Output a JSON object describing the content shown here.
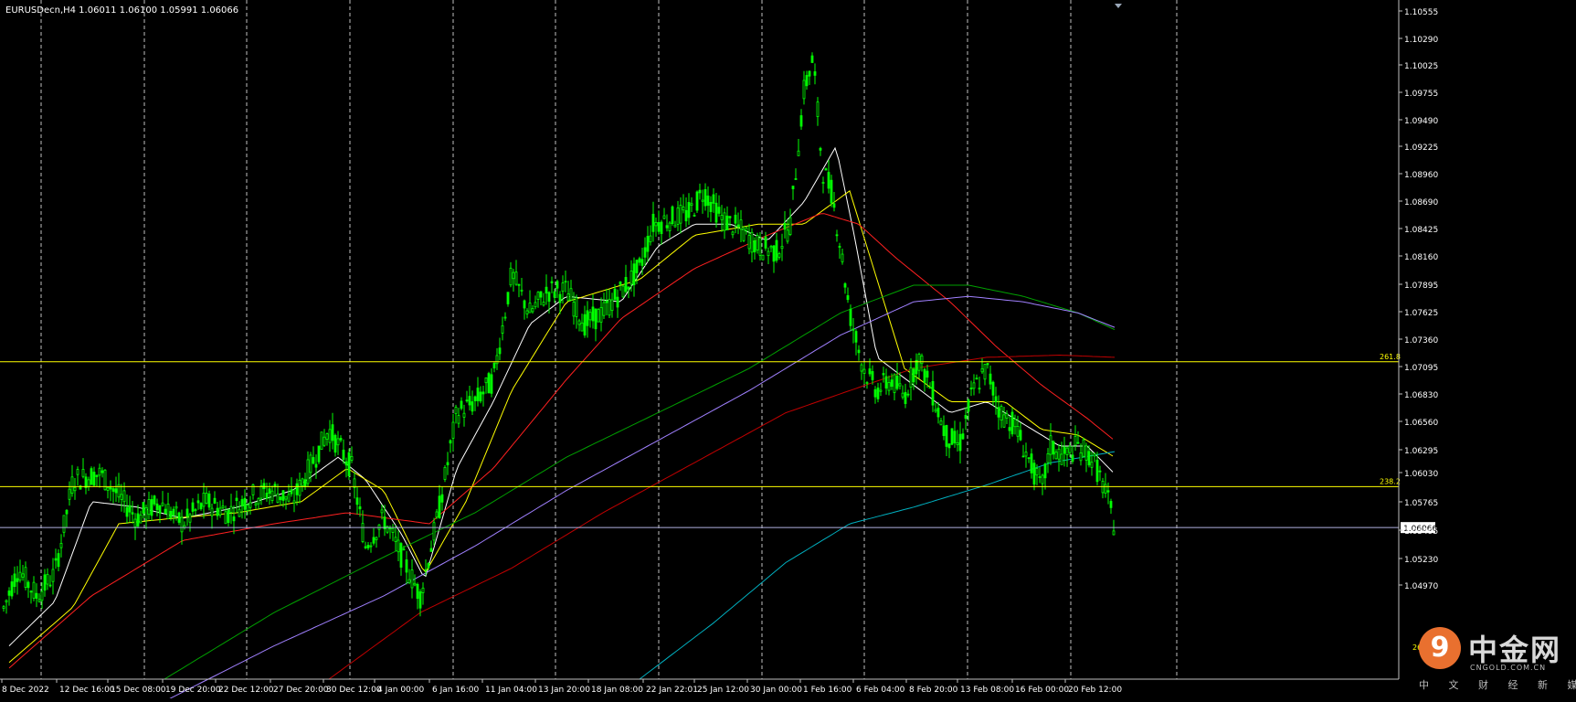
{
  "window": {
    "symbol_header": "EURUSDecn,H4  1.06011 1.06100 1.05991 1.06066"
  },
  "colors": {
    "background": "#000000",
    "axis": "#c0c0c0",
    "grid": "#c0c0c0",
    "bull": "#00ff00",
    "fib": "#ffff00",
    "bidline": "#b0b0e0",
    "ma_white": "#ffffff",
    "ma_yellow": "#ffff00",
    "ma_red": "#ff2020",
    "ma_green": "#00a000",
    "ma_violet": "#a080ff",
    "ma_darkred": "#c00000",
    "ma_cyan": "#00b0c0"
  },
  "chart_data": {
    "type": "candlestick",
    "timeframe": "H4",
    "ylim": [
      1.047,
      1.1082
    ],
    "y_ticks": [
      "1.10555",
      "1.10290",
      "1.10025",
      "1.09755",
      "1.09490",
      "1.09225",
      "1.08960",
      "1.08690",
      "1.08425",
      "1.08160",
      "1.07895",
      "1.07625",
      "1.07360",
      "1.07095",
      "1.06830",
      "1.06560",
      "1.06295",
      "1.06030",
      "1.05765",
      "1.05495",
      "1.05230",
      "1.04970"
    ],
    "x_ticks": [
      "8 Dec 2022",
      "12 Dec 16:00",
      "15 Dec 08:00",
      "19 Dec 20:00",
      "22 Dec 12:00",
      "27 Dec 20:00",
      "30 Dec 12:00",
      "4 Jan 00:00",
      "6 Jan 16:00",
      "11 Jan 04:00",
      "13 Jan 20:00",
      "18 Jan 08:00",
      "22 Jan 22:01",
      "25 Jan 12:00",
      "30 Jan 00:00",
      "1 Feb 16:00",
      "6 Feb 04:00",
      "8 Feb 20:00",
      "13 Feb 08:00",
      "16 Feb 00:00",
      "20 Feb 12:00"
    ],
    "price_anchors": [
      [
        0,
        1.0525
      ],
      [
        20,
        1.057
      ],
      [
        40,
        1.0545
      ],
      [
        60,
        1.0565
      ],
      [
        80,
        1.065
      ],
      [
        110,
        1.0655
      ],
      [
        130,
        1.0635
      ],
      [
        150,
        1.0615
      ],
      [
        175,
        1.063
      ],
      [
        200,
        1.061
      ],
      [
        225,
        1.063
      ],
      [
        250,
        1.062
      ],
      [
        275,
        1.0635
      ],
      [
        300,
        1.064
      ],
      [
        320,
        1.063
      ],
      [
        345,
        1.067
      ],
      [
        360,
        1.0695
      ],
      [
        385,
        1.066
      ],
      [
        400,
        1.059
      ],
      [
        420,
        1.0615
      ],
      [
        440,
        1.058
      ],
      [
        460,
        1.0545
      ],
      [
        480,
        1.062
      ],
      [
        500,
        1.071
      ],
      [
        520,
        1.072
      ],
      [
        540,
        1.074
      ],
      [
        560,
        1.0835
      ],
      [
        580,
        1.08
      ],
      [
        600,
        1.082
      ],
      [
        620,
        1.082
      ],
      [
        640,
        1.079
      ],
      [
        660,
        1.08
      ],
      [
        680,
        1.082
      ],
      [
        700,
        1.084
      ],
      [
        715,
        1.088
      ],
      [
        735,
        1.0885
      ],
      [
        755,
        1.089
      ],
      [
        770,
        1.091
      ],
      [
        790,
        1.0885
      ],
      [
        810,
        1.0875
      ],
      [
        830,
        1.086
      ],
      [
        850,
        1.0855
      ],
      [
        865,
        1.088
      ],
      [
        880,
        1.1
      ],
      [
        890,
        1.103
      ],
      [
        900,
        1.093
      ],
      [
        910,
        1.091
      ],
      [
        920,
        1.086
      ],
      [
        930,
        1.08
      ],
      [
        945,
        1.075
      ],
      [
        960,
        1.073
      ],
      [
        975,
        1.074
      ],
      [
        990,
        1.0725
      ],
      [
        1005,
        1.076
      ],
      [
        1020,
        1.073
      ],
      [
        1035,
        1.069
      ],
      [
        1050,
        1.068
      ],
      [
        1065,
        1.073
      ],
      [
        1080,
        1.075
      ],
      [
        1095,
        1.071
      ],
      [
        1110,
        1.07
      ],
      [
        1125,
        1.067
      ],
      [
        1140,
        1.064
      ],
      [
        1150,
        1.068
      ],
      [
        1165,
        1.067
      ],
      [
        1180,
        1.068
      ],
      [
        1195,
        1.067
      ],
      [
        1205,
        1.065
      ],
      [
        1213,
        1.063
      ],
      [
        1220,
        1.0607
      ]
    ],
    "moving_averages": [
      {
        "color_key": "ma_white",
        "anchors": [
          [
            10,
            1.05
          ],
          [
            60,
            1.054
          ],
          [
            100,
            1.063
          ],
          [
            150,
            1.0625
          ],
          [
            200,
            1.0615
          ],
          [
            260,
            1.0625
          ],
          [
            320,
            1.064
          ],
          [
            370,
            1.067
          ],
          [
            400,
            1.065
          ],
          [
            440,
            1.06
          ],
          [
            465,
            1.056
          ],
          [
            500,
            1.066
          ],
          [
            540,
            1.072
          ],
          [
            580,
            1.079
          ],
          [
            620,
            1.0815
          ],
          [
            680,
            1.081
          ],
          [
            720,
            1.086
          ],
          [
            760,
            1.088
          ],
          [
            800,
            1.088
          ],
          [
            840,
            1.0865
          ],
          [
            880,
            1.09
          ],
          [
            915,
            1.095
          ],
          [
            935,
            1.087
          ],
          [
            960,
            1.076
          ],
          [
            1000,
            1.0735
          ],
          [
            1040,
            1.071
          ],
          [
            1080,
            1.072
          ],
          [
            1120,
            1.07
          ],
          [
            1160,
            1.068
          ],
          [
            1190,
            1.068
          ],
          [
            1220,
            1.0655
          ]
        ]
      },
      {
        "color_key": "ma_yellow",
        "anchors": [
          [
            10,
            1.0485
          ],
          [
            80,
            1.0535
          ],
          [
            130,
            1.061
          ],
          [
            190,
            1.0615
          ],
          [
            260,
            1.062
          ],
          [
            330,
            1.063
          ],
          [
            380,
            1.066
          ],
          [
            420,
            1.064
          ],
          [
            465,
            1.0565
          ],
          [
            510,
            1.063
          ],
          [
            560,
            1.073
          ],
          [
            620,
            1.081
          ],
          [
            700,
            1.083
          ],
          [
            760,
            1.087
          ],
          [
            830,
            1.088
          ],
          [
            880,
            1.088
          ],
          [
            930,
            1.091
          ],
          [
            960,
            1.083
          ],
          [
            990,
            1.075
          ],
          [
            1040,
            1.072
          ],
          [
            1100,
            1.072
          ],
          [
            1140,
            1.0695
          ],
          [
            1180,
            1.069
          ],
          [
            1220,
            1.067
          ]
        ]
      },
      {
        "color_key": "ma_red",
        "anchors": [
          [
            10,
            1.048
          ],
          [
            100,
            1.0545
          ],
          [
            200,
            1.0595
          ],
          [
            300,
            1.061
          ],
          [
            380,
            1.062
          ],
          [
            470,
            1.061
          ],
          [
            540,
            1.066
          ],
          [
            620,
            1.074
          ],
          [
            680,
            1.0795
          ],
          [
            760,
            1.084
          ],
          [
            840,
            1.087
          ],
          [
            900,
            1.089
          ],
          [
            940,
            1.088
          ],
          [
            980,
            1.085
          ],
          [
            1040,
            1.081
          ],
          [
            1090,
            1.077
          ],
          [
            1140,
            1.0735
          ],
          [
            1190,
            1.0705
          ],
          [
            1220,
            1.0685
          ]
        ]
      },
      {
        "color_key": "ma_green",
        "anchors": [
          [
            180,
            1.047
          ],
          [
            300,
            1.053
          ],
          [
            420,
            1.058
          ],
          [
            520,
            1.062
          ],
          [
            620,
            1.067
          ],
          [
            720,
            1.071
          ],
          [
            820,
            1.075
          ],
          [
            920,
            1.08
          ],
          [
            1000,
            1.0825
          ],
          [
            1060,
            1.0825
          ],
          [
            1120,
            1.0815
          ],
          [
            1180,
            1.08
          ],
          [
            1220,
            1.0785
          ]
        ]
      },
      {
        "color_key": "ma_violet",
        "anchors": [
          [
            180,
            1.045
          ],
          [
            300,
            1.05
          ],
          [
            420,
            1.0545
          ],
          [
            520,
            1.059
          ],
          [
            620,
            1.064
          ],
          [
            720,
            1.0685
          ],
          [
            820,
            1.073
          ],
          [
            920,
            1.078
          ],
          [
            1000,
            1.081
          ],
          [
            1060,
            1.0815
          ],
          [
            1120,
            1.081
          ],
          [
            1180,
            1.08
          ],
          [
            1220,
            1.0787
          ]
        ]
      },
      {
        "color_key": "ma_darkred",
        "anchors": [
          [
            360,
            1.047
          ],
          [
            460,
            1.053
          ],
          [
            560,
            1.057
          ],
          [
            660,
            1.062
          ],
          [
            760,
            1.0665
          ],
          [
            860,
            1.071
          ],
          [
            930,
            1.073
          ],
          [
            1000,
            1.075
          ],
          [
            1080,
            1.076
          ],
          [
            1160,
            1.0762
          ],
          [
            1220,
            1.076
          ]
        ]
      },
      {
        "color_key": "ma_cyan",
        "anchors": [
          [
            700,
            1.047
          ],
          [
            780,
            1.052
          ],
          [
            860,
            1.0575
          ],
          [
            930,
            1.061
          ],
          [
            1000,
            1.0625
          ],
          [
            1080,
            1.0645
          ],
          [
            1150,
            1.0665
          ],
          [
            1220,
            1.0675
          ]
        ]
      }
    ],
    "hlines": [
      {
        "label": "261.8",
        "price": 1.0756,
        "color_key": "fib"
      },
      {
        "label": "238.2",
        "price": 1.06435,
        "color_key": "fib"
      },
      {
        "label": "1.06066",
        "price": 1.06066,
        "color_key": "bidline"
      }
    ],
    "bid_label": "1.06066",
    "fib_label_top": "261.8",
    "fib_label_bottom": "238.2"
  },
  "watermark": {
    "logo_glyph": "9",
    "brand_cn": "中金网",
    "url": "CNGOLD.COM.CN",
    "tagline": "中 文 财 经 新 媒 体",
    "partial_value": "262.7"
  }
}
